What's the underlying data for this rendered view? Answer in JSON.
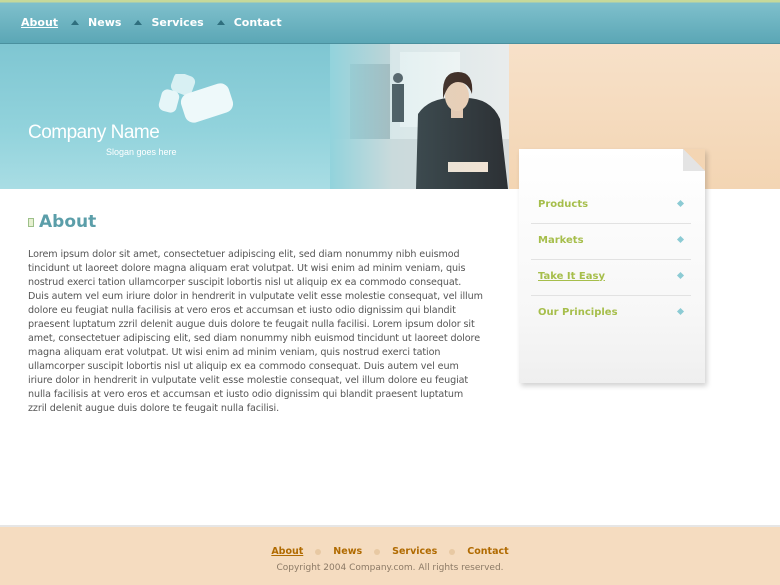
{
  "top_nav": {
    "items": [
      {
        "label": "About",
        "active": true
      },
      {
        "label": "News",
        "active": false
      },
      {
        "label": "Services",
        "active": false
      },
      {
        "label": "Contact",
        "active": false
      }
    ]
  },
  "header": {
    "company_name": "Company Name",
    "slogan": "Slogan goes here"
  },
  "sidebar": {
    "items": [
      {
        "label": "Products",
        "icon": "diamond-bullet-icon",
        "highlighted": false
      },
      {
        "label": "Markets",
        "icon": "diamond-bullet-icon",
        "highlighted": false
      },
      {
        "label": "Take It Easy",
        "icon": "diamond-bullet-icon",
        "highlighted": true
      },
      {
        "label": "Our Principles",
        "icon": "diamond-bullet-icon",
        "highlighted": false
      }
    ]
  },
  "main": {
    "title": "About",
    "body": "Lorem ipsum dolor sit amet, consectetuer adipiscing elit, sed diam nonummy nibh euismod tincidunt ut laoreet dolore magna aliquam erat volutpat. Ut wisi enim ad minim veniam, quis nostrud exerci tation ullamcorper suscipit lobortis nisl ut aliquip ex ea commodo consequat. Duis autem vel eum iriure dolor in hendrerit in vulputate velit esse molestie consequat, vel illum dolore eu feugiat nulla facilisis at vero eros et accumsan et iusto odio dignissim qui blandit praesent luptatum zzril delenit augue duis dolore te feugait nulla facilisi. Lorem ipsum dolor sit amet, consectetuer adipiscing elit, sed diam nonummy nibh euismod tincidunt ut laoreet dolore magna aliquam erat volutpat. Ut wisi enim ad minim veniam, quis nostrud exerci tation ullamcorper suscipit lobortis nisl ut aliquip ex ea commodo consequat. Duis autem vel eum iriure dolor in hendrerit in vulputate velit esse molestie consequat, vel illum dolore eu feugiat nulla facilisis at vero eros et accumsan et iusto odio dignissim qui blandit praesent luptatum zzril delenit augue duis dolore te feugait nulla facilisi."
  },
  "footer": {
    "items": [
      {
        "label": "About",
        "active": true
      },
      {
        "label": "News",
        "active": false
      },
      {
        "label": "Services",
        "active": false
      },
      {
        "label": "Contact",
        "active": false
      }
    ],
    "copyright": "Copyright 2004 Company.com. All rights reserved."
  },
  "colors": {
    "nav_bar": "#5aa6b5",
    "banner": "#92d3dc",
    "heading": "#5b9ea9",
    "sidebar_link": "#a6be4b",
    "footer_bg": "#f5dcc0",
    "footer_link": "#b06a00"
  }
}
